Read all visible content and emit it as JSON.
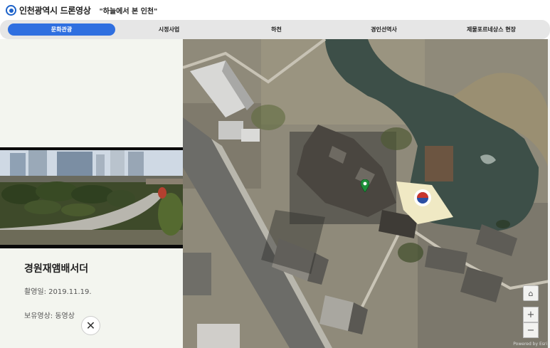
{
  "header": {
    "site_title": "인천광역시 드론영상",
    "subtitle": "\"하늘에서 본 인천\""
  },
  "tabs": [
    {
      "label": "문화관광",
      "active": true
    },
    {
      "label": "시정사업",
      "active": false
    },
    {
      "label": "하천",
      "active": false
    },
    {
      "label": "경인선역사",
      "active": false
    },
    {
      "label": "제물포르네상스 현장",
      "active": false
    }
  ],
  "detail": {
    "place_name": "경원재앰배서더",
    "date_line": "촬영일: 2019.11.19.",
    "media_line": "보유영상: 동영상",
    "close_icon": "close-icon"
  },
  "map": {
    "attribution": "Powered by Esri",
    "home_icon": "home-icon",
    "zoom_in_label": "+",
    "zoom_out_label": "−",
    "marker_icon": "map-pin-icon",
    "marker_color": "#1f8f3a"
  },
  "colors": {
    "accent": "#2f6fe0",
    "panel_bg": "#f3f5ef",
    "tab_bg": "#e6e6e6"
  }
}
